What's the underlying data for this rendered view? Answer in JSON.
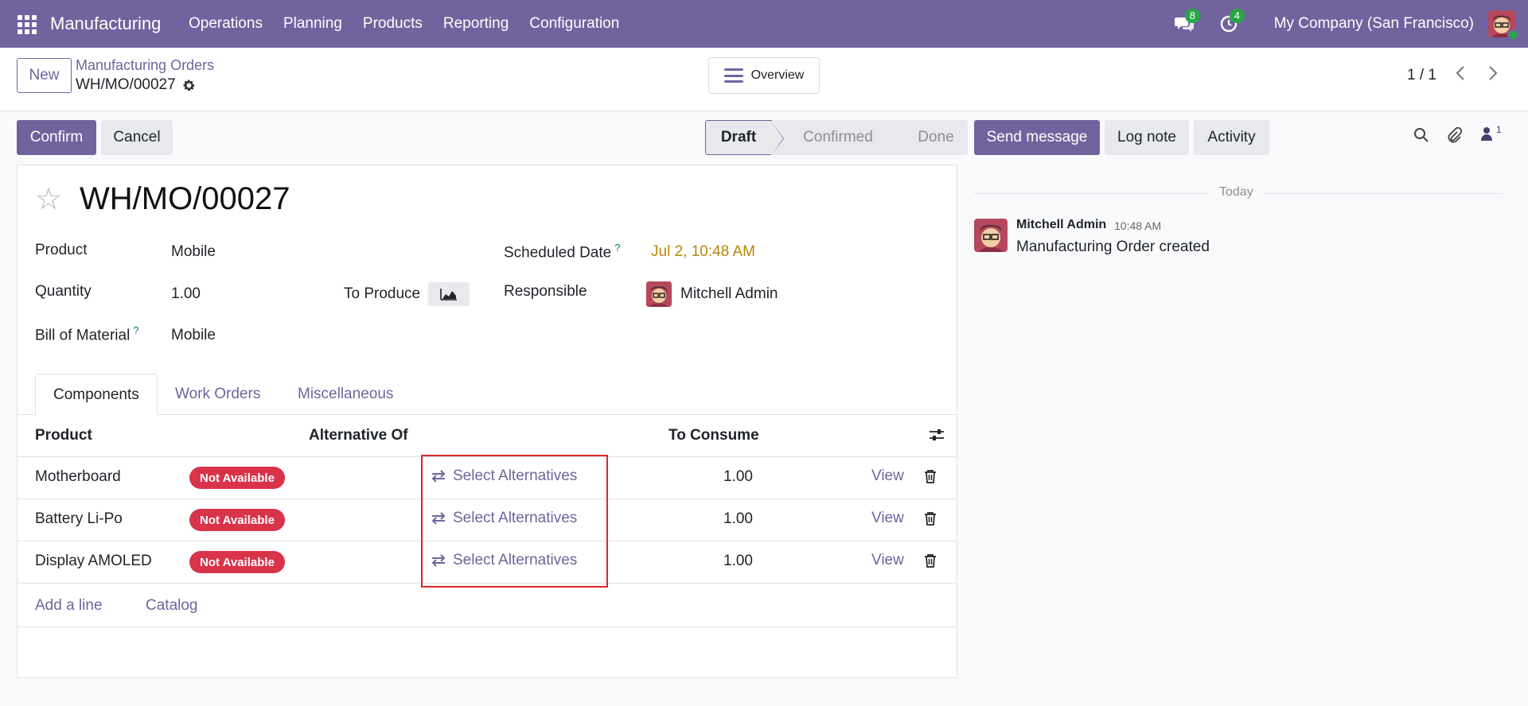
{
  "navbar": {
    "app_name": "Manufacturing",
    "menu": [
      "Operations",
      "Planning",
      "Products",
      "Reporting",
      "Configuration"
    ],
    "messages_count": "8",
    "activities_count": "4",
    "company": "My Company (San Francisco)"
  },
  "control_panel": {
    "new_label": "New",
    "breadcrumb_parent": "Manufacturing Orders",
    "breadcrumb_current": "WH/MO/00027",
    "overview_label": "Overview",
    "pager": "1 / 1"
  },
  "actions": {
    "confirm_label": "Confirm",
    "cancel_label": "Cancel"
  },
  "statusbar": {
    "stages": [
      "Draft",
      "Confirmed",
      "Done"
    ],
    "active": "Draft"
  },
  "form": {
    "title": "WH/MO/00027",
    "product_label": "Product",
    "product_value": "Mobile",
    "quantity_label": "Quantity",
    "quantity_value": "1.00",
    "to_produce_label": "To Produce",
    "bom_label": "Bill of Material",
    "bom_value": "Mobile",
    "scheduled_label": "Scheduled Date",
    "scheduled_value": "Jul 2, 10:48 AM",
    "responsible_label": "Responsible",
    "responsible_value": "Mitchell Admin",
    "help_mark": "?"
  },
  "tabs": [
    "Components",
    "Work Orders",
    "Miscellaneous"
  ],
  "components_table": {
    "columns": [
      "Product",
      "Alternative Of",
      "To Consume"
    ],
    "rows": [
      {
        "product": "Motherboard",
        "status": "Not Available",
        "alt": "Select Alternatives",
        "qty": "1.00",
        "view": "View"
      },
      {
        "product": "Battery Li-Po",
        "status": "Not Available",
        "alt": "Select Alternatives",
        "qty": "1.00",
        "view": "View"
      },
      {
        "product": "Display AMOLED",
        "status": "Not Available",
        "alt": "Select Alternatives",
        "qty": "1.00",
        "view": "View"
      }
    ],
    "add_line": "Add a line",
    "catalog": "Catalog"
  },
  "chatter": {
    "send_message": "Send message",
    "log_note": "Log note",
    "activity": "Activity",
    "followers_count": "1",
    "date_separator": "Today",
    "message": {
      "author": "Mitchell Admin",
      "time": "10:48 AM",
      "body": "Manufacturing Order created"
    }
  },
  "colors": {
    "brand": "#71639e",
    "danger": "#d9334a",
    "highlight": "#e02424",
    "date": "#b8860b"
  }
}
